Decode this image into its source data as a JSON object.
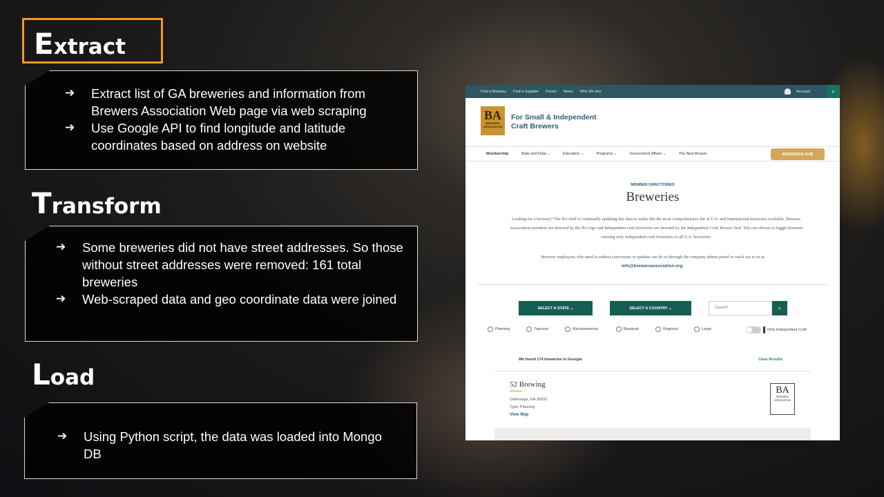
{
  "slide": {
    "extract": {
      "initial": "E",
      "rest": "xtract",
      "bullets": [
        "Extract list of GA breweries and information from Brewers Association Web page via web scraping",
        "Use Google API to find longitude and latitude coordinates based on address on website"
      ]
    },
    "transform": {
      "initial": "T",
      "rest": "ransform",
      "bullets": [
        "Some breweries did not have street addresses. So those without street addresses were removed: 161 total breweries",
        "Web-scraped data and geo coordinate data were joined"
      ]
    },
    "load": {
      "initial": "L",
      "rest": "oad",
      "bullets": [
        "Using Python script, the data was loaded into Mongo DB"
      ]
    },
    "arrow": "➔"
  },
  "website": {
    "topnav": [
      "Find a Brewery",
      "Find a Supplier",
      "Forum",
      "News",
      "Who We Are"
    ],
    "account": "Account",
    "search_icon": "⌕",
    "logo": {
      "letters": "BA",
      "sub": "BREWERS ASSOCIATION"
    },
    "tagline": [
      "For Small & Independent",
      "Craft Brewers"
    ],
    "mainnav": [
      "Membership",
      "Stats and Data ⌄",
      "Education ⌄",
      "Programs ⌄",
      "Government Affairs ⌄",
      "The New Brewer"
    ],
    "resource_hub": "RESOURCE HUB",
    "directory_label": "MEMBER DIRECTORIES",
    "directory_title": "Breweries",
    "description": "Looking for a brewery? The BA staff is continually updating this data to make this the most comprehensive list of U.S. and international breweries available. Brewers Association members are denoted by the BA logo and Independent craft breweries are denoted by the Independent Craft Brewer Seal. You can choose to toggle between viewing only independent craft breweries or all U.S. breweries.",
    "corrections": "Brewery employees who need to submit corrections or updates can do so through the company admin portal or reach out to us at",
    "email": "info@brewersassociation.org.",
    "select_state": "SELECT A STATE  ⌄",
    "select_country": "SELECT A COUNTRY  ⌄",
    "search_placeholder": "Search",
    "filters": [
      "Planning",
      "Taproom",
      "Microbreweries",
      "Brewpub",
      "Regional",
      "Large"
    ],
    "independent_toggle": "Only Independent Craft",
    "found_text": "We found 174 breweries in Georgia",
    "clear_results": "Clear Results",
    "brewery": {
      "name": "52 Brewing",
      "location": "Dahlonega, GA 30533",
      "type": "Type: Planning",
      "view_map": "View Map",
      "member_badge": {
        "letters": "BA",
        "sub": "BREWERS ASSOCIATION"
      }
    }
  }
}
